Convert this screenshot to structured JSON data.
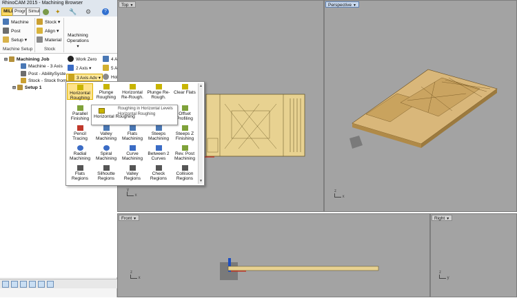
{
  "app": {
    "title": "RhinoCAM 2015 - Machining Browser",
    "colors": {
      "accent": "#ffd966",
      "part": "#e8d291",
      "viewport_bg": "#a3a3a3",
      "highlight": "#ffe38a"
    }
  },
  "tabs": [
    "MILL",
    "Prograr",
    "Simulat"
  ],
  "tab_icons": [
    "gear-icon",
    "star-icon",
    "wrench-icon",
    "settings-icon",
    "help-icon"
  ],
  "ribbon": {
    "machine_setup": {
      "machine": "Machine",
      "post": "Post",
      "setup": "Setup",
      "group_label": "Machine Setup"
    },
    "stock": {
      "stock": "Stock",
      "align": "Align",
      "material": "Material",
      "group_label": "Stock"
    },
    "machining_operations": {
      "label": "Machining Operations"
    }
  },
  "tree": {
    "items": [
      {
        "label": "Machining Job"
      },
      {
        "label": "Machine - 3 Axis"
      },
      {
        "label": "Post - AbilitySyste"
      },
      {
        "label": "Stock - Stock from"
      },
      {
        "label": "Setup 1"
      }
    ]
  },
  "toolbar2": {
    "work_zero": "Work Zero",
    "four_axis": "4 Axis",
    "two_axis": "2 Axis",
    "five_axis": "5 Axis",
    "three_axis_adv": "3 Axis Adv",
    "holes": "Holes"
  },
  "menu": {
    "items": [
      [
        "Horizontal Roughing",
        "Plunge Roughing",
        "Horizontal Re-Rough.",
        "Plunge Re-Rough.",
        "Clear Flats"
      ],
      [
        "Parallel Finishing",
        "",
        "",
        "",
        "Offset Profiling"
      ],
      [
        "Pencil Tracing",
        "Valley Machining",
        "Flats Machining",
        "Steeps Machining",
        "Steeps Z Finishing"
      ],
      [
        "Radial Machining",
        "Spiral Machining",
        "Curve Machining",
        "Between 2 Curves",
        "Rev. Post Machining"
      ],
      [
        "Flats Regions",
        "Silhoutte Regions",
        "Valley Regions",
        "Check Regions",
        "Collision Regions"
      ]
    ],
    "highlighted": "Horizontal Roughing"
  },
  "tooltip": {
    "icon_label": "Horizontal Roughing",
    "title": "Roughing  in Horizontal Levels",
    "description": "Horizontal Roughing"
  },
  "viewports": {
    "top": "Top",
    "perspective": "Perspective",
    "front": "Front",
    "right": "Right",
    "axis_y": "y",
    "axis_x": "x",
    "axis_z": "z"
  }
}
